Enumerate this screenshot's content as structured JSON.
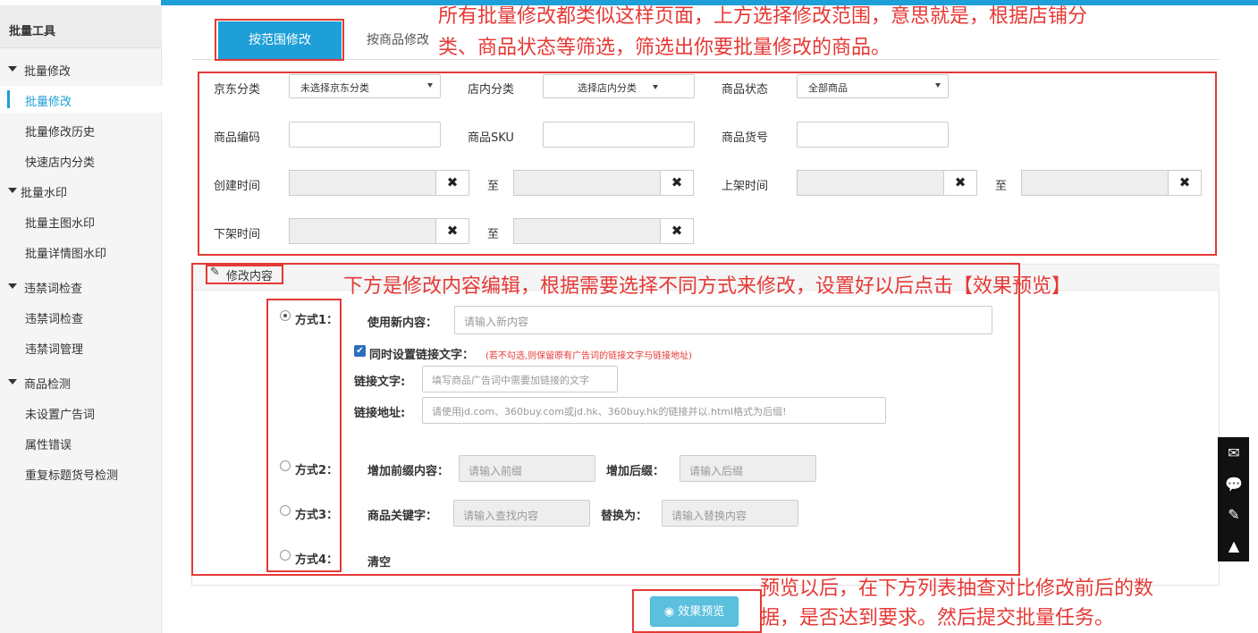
{
  "sidebar": {
    "header": "批量工具",
    "items": [
      {
        "label": "批量修改",
        "type": "group"
      },
      {
        "label": "批量修改",
        "type": "sub",
        "active": true
      },
      {
        "label": "批量修改历史",
        "type": "sub"
      },
      {
        "label": "快速店内分类",
        "type": "sub"
      },
      {
        "label": "批量水印",
        "type": "group"
      },
      {
        "label": "批量主图水印",
        "type": "sub"
      },
      {
        "label": "批量详情图水印",
        "type": "sub"
      },
      {
        "label": "违禁词检查",
        "type": "group"
      },
      {
        "label": "违禁词检查",
        "type": "sub"
      },
      {
        "label": "违禁词管理",
        "type": "sub"
      },
      {
        "label": "商品检测",
        "type": "group"
      },
      {
        "label": "未设置广告词",
        "type": "sub"
      },
      {
        "label": "属性错误",
        "type": "sub"
      },
      {
        "label": "重复标题货号检测",
        "type": "sub"
      }
    ]
  },
  "tabs": {
    "range": "按范围修改",
    "product": "按商品修改"
  },
  "annotations": {
    "top_line1": "所有批量修改都类似这样页面，上方选择修改范围，意思就是，根据店铺分",
    "top_line2": "类、商品状态等筛选，筛选出你要批量修改的商品。",
    "middle": "下方是修改内容编辑，根据需要选择不同方式来修改，设置好以后点击【效果预览】",
    "bottom_line1": "预览以后，在下方列表抽查对比修改前后的数",
    "bottom_line2": "据，是否达到要求。然后提交批量任务。"
  },
  "filter": {
    "jd_category_label": "京东分类",
    "jd_category_value": "未选择京东分类",
    "shop_category_label": "店内分类",
    "shop_category_value": "选择店内分类",
    "status_label": "商品状态",
    "status_value": "全部商品",
    "code_label": "商品编码",
    "sku_label": "商品SKU",
    "item_no_label": "商品货号",
    "create_time_label": "创建时间",
    "to": "至",
    "list_time_label": "上架时间",
    "delist_time_label": "下架时间",
    "clear_glyph": "✖"
  },
  "edit": {
    "section_title": "修改内容",
    "mode1": "方式1：",
    "use_new_label": "使用新内容：",
    "use_new_placeholder": "请输入新内容",
    "link_check_label": "同时设置链接文字：",
    "link_check_hint": "(若不勾选,则保留原有广告词的链接文字与链接地址)",
    "link_text_label": "链接文字:",
    "link_text_placeholder": "填写商品广告词中需要加链接的文字",
    "link_url_label": "链接地址:",
    "link_url_placeholder": "请使用jd.com、360buy.com或jd.hk、360buy.hk的链接并以.html格式为后缀!",
    "mode2": "方式2：",
    "prefix_label": "增加前缀内容：",
    "prefix_placeholder": "请输入前缀",
    "suffix_label": "增加后缀：",
    "suffix_placeholder": "请输入后缀",
    "mode3": "方式3：",
    "keyword_label": "商品关键字：",
    "keyword_placeholder": "请输入查找内容",
    "replace_label": "替换为：",
    "replace_placeholder": "请输入替换内容",
    "mode4": "方式4：",
    "clear_label": "清空",
    "selected_mode": 1,
    "link_checked": true
  },
  "preview_button": "效果预览",
  "colors": {
    "accent": "#1e9fd7",
    "annotation": "#e53935",
    "preview": "#5bc0de"
  }
}
